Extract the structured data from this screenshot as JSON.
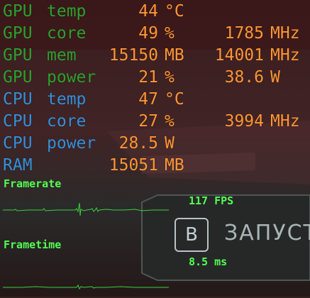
{
  "colors": {
    "gpu": "#2ea12e",
    "cpu": "#3590da",
    "ram": "#3590da",
    "value": "#ff9633",
    "graph": "#52ff52"
  },
  "rows": {
    "gpu_temp": {
      "label1": "GPU",
      "label2": "temp",
      "value1": "44",
      "unit1": "°C",
      "value2": "",
      "unit2": ""
    },
    "gpu_core": {
      "label1": "GPU",
      "label2": "core",
      "value1": "49",
      "unit1": "%",
      "value2": "1785",
      "unit2": "MHz"
    },
    "gpu_mem": {
      "label1": "GPU",
      "label2": "mem",
      "value1": "15150",
      "unit1": "MB",
      "value2": "14001",
      "unit2": "MHz"
    },
    "gpu_power": {
      "label1": "GPU",
      "label2": "power",
      "value1": "21",
      "unit1": "%",
      "value2": "38.6",
      "unit2": "W"
    },
    "cpu_temp": {
      "label1": "CPU",
      "label2": "temp",
      "value1": "47",
      "unit1": "°C"
    },
    "cpu_core": {
      "label1": "CPU",
      "label2": "core",
      "value1": "27",
      "unit1": "%",
      "value2": "3994",
      "unit2": "MHz"
    },
    "cpu_power": {
      "label1": "CPU",
      "label2": "power",
      "value1": "28.5",
      "unit1": "W"
    },
    "ram": {
      "label1": "RAM",
      "value1": "15051",
      "unit1": "MB"
    }
  },
  "framerate": {
    "title": "Framerate",
    "value": "117 FPS"
  },
  "frametime": {
    "title": "Frametime",
    "value": "8.5 ms"
  },
  "background": {
    "button_key": "B",
    "button_text": "ЗАПУСТ"
  }
}
